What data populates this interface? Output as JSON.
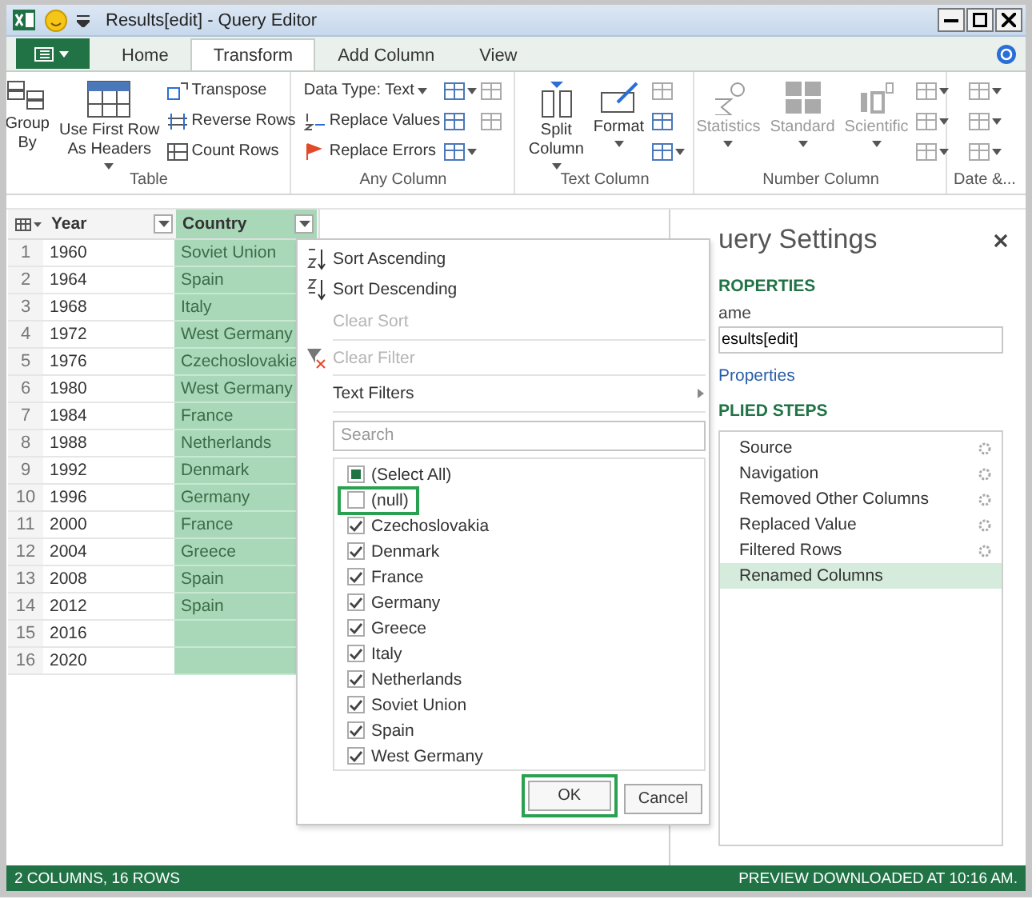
{
  "window": {
    "title": "Results[edit] - Query Editor"
  },
  "ribbon": {
    "tabs": [
      {
        "label": "Home",
        "selected": false
      },
      {
        "label": "Transform",
        "selected": true
      },
      {
        "label": "Add Column",
        "selected": false
      },
      {
        "label": "View",
        "selected": false
      }
    ],
    "groups": [
      {
        "label": "Table",
        "columns": [
          [
            {
              "kind": "large",
              "label": "Group\nBy",
              "dropdown": false,
              "disabled": false
            }
          ],
          [
            {
              "kind": "large",
              "label": "Use First Row\nAs Headers",
              "dropdown": true,
              "disabled": false
            }
          ],
          [
            {
              "kind": "small",
              "label": "Transpose",
              "dropdown": false,
              "disabled": false
            },
            {
              "kind": "small",
              "label": "Reverse Rows",
              "dropdown": false,
              "disabled": false
            },
            {
              "kind": "small",
              "label": "Count Rows",
              "dropdown": false,
              "disabled": false
            }
          ]
        ]
      },
      {
        "label": "Any Column",
        "columns": [
          [
            {
              "kind": "text",
              "label": "Data Type: Text",
              "dropdown": true,
              "disabled": false
            },
            {
              "kind": "small",
              "label": "Replace Values",
              "dropdown": false,
              "disabled": false
            },
            {
              "kind": "small",
              "label": "Replace Errors",
              "dropdown": false,
              "disabled": false
            }
          ],
          [
            {
              "kind": "icon",
              "dropdown": true,
              "disabled": false
            },
            {
              "kind": "icon",
              "dropdown": false,
              "disabled": false
            },
            {
              "kind": "icon",
              "dropdown": true,
              "disabled": false
            }
          ],
          [
            {
              "kind": "icon",
              "dropdown": false,
              "disabled": true
            },
            {
              "kind": "icon",
              "dropdown": false,
              "disabled": true
            }
          ]
        ]
      },
      {
        "label": "Text Column",
        "columns": [
          [
            {
              "kind": "large",
              "label": "Split\nColumn",
              "dropdown": true,
              "disabled": false
            }
          ],
          [
            {
              "kind": "large",
              "label": "Format",
              "dropdown": true,
              "disabled": false
            }
          ],
          [
            {
              "kind": "icon",
              "dropdown": false,
              "disabled": true
            },
            {
              "kind": "icon",
              "dropdown": false,
              "disabled": false
            },
            {
              "kind": "icon",
              "dropdown": true,
              "disabled": false
            }
          ]
        ]
      },
      {
        "label": "Number Column",
        "columns": [
          [
            {
              "kind": "large",
              "label": "Statistics",
              "dropdown": true,
              "disabled": true
            }
          ],
          [
            {
              "kind": "large",
              "label": "Standard",
              "dropdown": true,
              "disabled": true
            }
          ],
          [
            {
              "kind": "large",
              "label": "Scientific",
              "dropdown": true,
              "disabled": true
            }
          ],
          [
            {
              "kind": "icon",
              "dropdown": true,
              "disabled": true
            },
            {
              "kind": "icon",
              "dropdown": true,
              "disabled": true
            },
            {
              "kind": "icon",
              "dropdown": true,
              "disabled": true
            }
          ]
        ]
      },
      {
        "label": "Date &...",
        "columns": [
          [
            {
              "kind": "icon",
              "dropdown": true,
              "disabled": true
            },
            {
              "kind": "icon",
              "dropdown": true,
              "disabled": true
            },
            {
              "kind": "icon",
              "dropdown": true,
              "disabled": true
            }
          ]
        ]
      }
    ]
  },
  "table": {
    "columns": [
      {
        "label": "Year",
        "selected": false
      },
      {
        "label": "Country",
        "selected": true
      }
    ],
    "rows": [
      {
        "number": "1",
        "year": "1960",
        "country": "Soviet Union"
      },
      {
        "number": "2",
        "year": "1964",
        "country": "Spain"
      },
      {
        "number": "3",
        "year": "1968",
        "country": "Italy"
      },
      {
        "number": "4",
        "year": "1972",
        "country": "West Germany"
      },
      {
        "number": "5",
        "year": "1976",
        "country": "Czechoslovakia"
      },
      {
        "number": "6",
        "year": "1980",
        "country": "West Germany"
      },
      {
        "number": "7",
        "year": "1984",
        "country": "France"
      },
      {
        "number": "8",
        "year": "1988",
        "country": "Netherlands"
      },
      {
        "number": "9",
        "year": "1992",
        "country": "Denmark"
      },
      {
        "number": "10",
        "year": "1996",
        "country": "Germany"
      },
      {
        "number": "11",
        "year": "2000",
        "country": "France"
      },
      {
        "number": "12",
        "year": "2004",
        "country": "Greece"
      },
      {
        "number": "13",
        "year": "2008",
        "country": "Spain"
      },
      {
        "number": "14",
        "year": "2012",
        "country": "Spain"
      },
      {
        "number": "15",
        "year": "2016"
      },
      {
        "number": "16",
        "year": "2020"
      }
    ]
  },
  "filter_menu": {
    "items": [
      {
        "kind": "sort_asc",
        "label": "Sort Ascending",
        "disabled": false
      },
      {
        "kind": "sort_desc",
        "label": "Sort Descending",
        "disabled": false
      },
      {
        "kind": "plain",
        "label": "Clear Sort",
        "disabled": true
      },
      {
        "kind": "clear_filter",
        "label": "Clear Filter",
        "disabled": true
      },
      {
        "kind": "submenu",
        "label": "Text Filters",
        "disabled": false
      }
    ],
    "search": {
      "placeholder": "Search"
    },
    "select_all": {
      "label": "(Select All)",
      "mixed": true
    },
    "values": [
      {
        "label": "(null)",
        "checked": false,
        "highlighted": true
      },
      {
        "label": "Czechoslovakia",
        "checked": true,
        "highlighted": false
      },
      {
        "label": "Denmark",
        "checked": true,
        "highlighted": false
      },
      {
        "label": "France",
        "checked": true,
        "highlighted": false
      },
      {
        "label": "Germany",
        "checked": true,
        "highlighted": false
      },
      {
        "label": "Greece",
        "checked": true,
        "highlighted": false
      },
      {
        "label": "Italy",
        "checked": true,
        "highlighted": false
      },
      {
        "label": "Netherlands",
        "checked": true,
        "highlighted": false
      },
      {
        "label": "Soviet Union",
        "checked": true,
        "highlighted": false
      },
      {
        "label": "Spain",
        "checked": true,
        "highlighted": false
      },
      {
        "label": "West Germany",
        "checked": true,
        "highlighted": false
      }
    ],
    "buttons": [
      {
        "label": "OK",
        "highlighted": true
      },
      {
        "label": "Cancel",
        "highlighted": false
      }
    ]
  },
  "query_settings": {
    "title": "uery Settings",
    "properties_heading": "ROPERTIES",
    "name_label": "ame",
    "name_value": "esults[edit]",
    "properties_link": "Properties",
    "steps_heading": "PLIED STEPS",
    "steps": [
      {
        "label": "Source",
        "selected": false
      },
      {
        "label": "Navigation",
        "selected": false
      },
      {
        "label": "Removed Other Columns",
        "selected": false
      },
      {
        "label": "Replaced Value",
        "selected": false
      },
      {
        "label": "Filtered Rows",
        "selected": false
      },
      {
        "label": "Renamed Columns",
        "selected": true
      }
    ]
  },
  "status_bar": {
    "left": "2 COLUMNS, 16 ROWS",
    "right": "PREVIEW DOWNLOADED AT 10:16 AM."
  }
}
